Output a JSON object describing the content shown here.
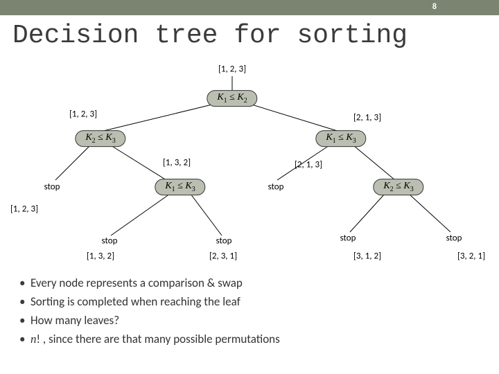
{
  "page_number": "8",
  "title": "Decision tree for sorting",
  "nodes": {
    "root": {
      "k1": "K",
      "s1": "1",
      "op": "≤",
      "k2": "K",
      "s2": "2"
    },
    "L": {
      "k1": "K",
      "s1": "2",
      "op": "≤",
      "k2": "K",
      "s2": "3"
    },
    "R": {
      "k1": "K",
      "s1": "1",
      "op": "≤",
      "k2": "K",
      "s2": "3"
    },
    "LR": {
      "k1": "K",
      "s1": "1",
      "op": "≤",
      "k2": "K",
      "s2": "3"
    },
    "RR": {
      "k1": "K",
      "s1": "2",
      "op": "≤",
      "k2": "K",
      "s2": "3"
    }
  },
  "edge_labels": {
    "root_in": "[1, 2, 3]",
    "root_L": "[1, 2, 3]",
    "root_R": "[2, 1, 3]",
    "L_stop": "stop",
    "L_LR": "[1, 3, 2]",
    "R_stop": "stop",
    "R_RR": "[2, 1, 3]",
    "LR_res": "[1, 2, 3]",
    "LR_stop1": "stop",
    "LR_out1": "[1, 3, 2]",
    "LR_stop2": "stop",
    "LR_out2": "[2, 3, 1]",
    "RR_stop1": "stop",
    "RR_out1": "[3, 1, 2]",
    "RR_stop2": "stop",
    "RR_out2": "[3, 2, 1]"
  },
  "bullets": [
    "Every node represents a comparison & swap",
    "Sorting is completed when reaching the leaf",
    "How many leaves?",
    "n! , since there are that many possible permutations"
  ]
}
